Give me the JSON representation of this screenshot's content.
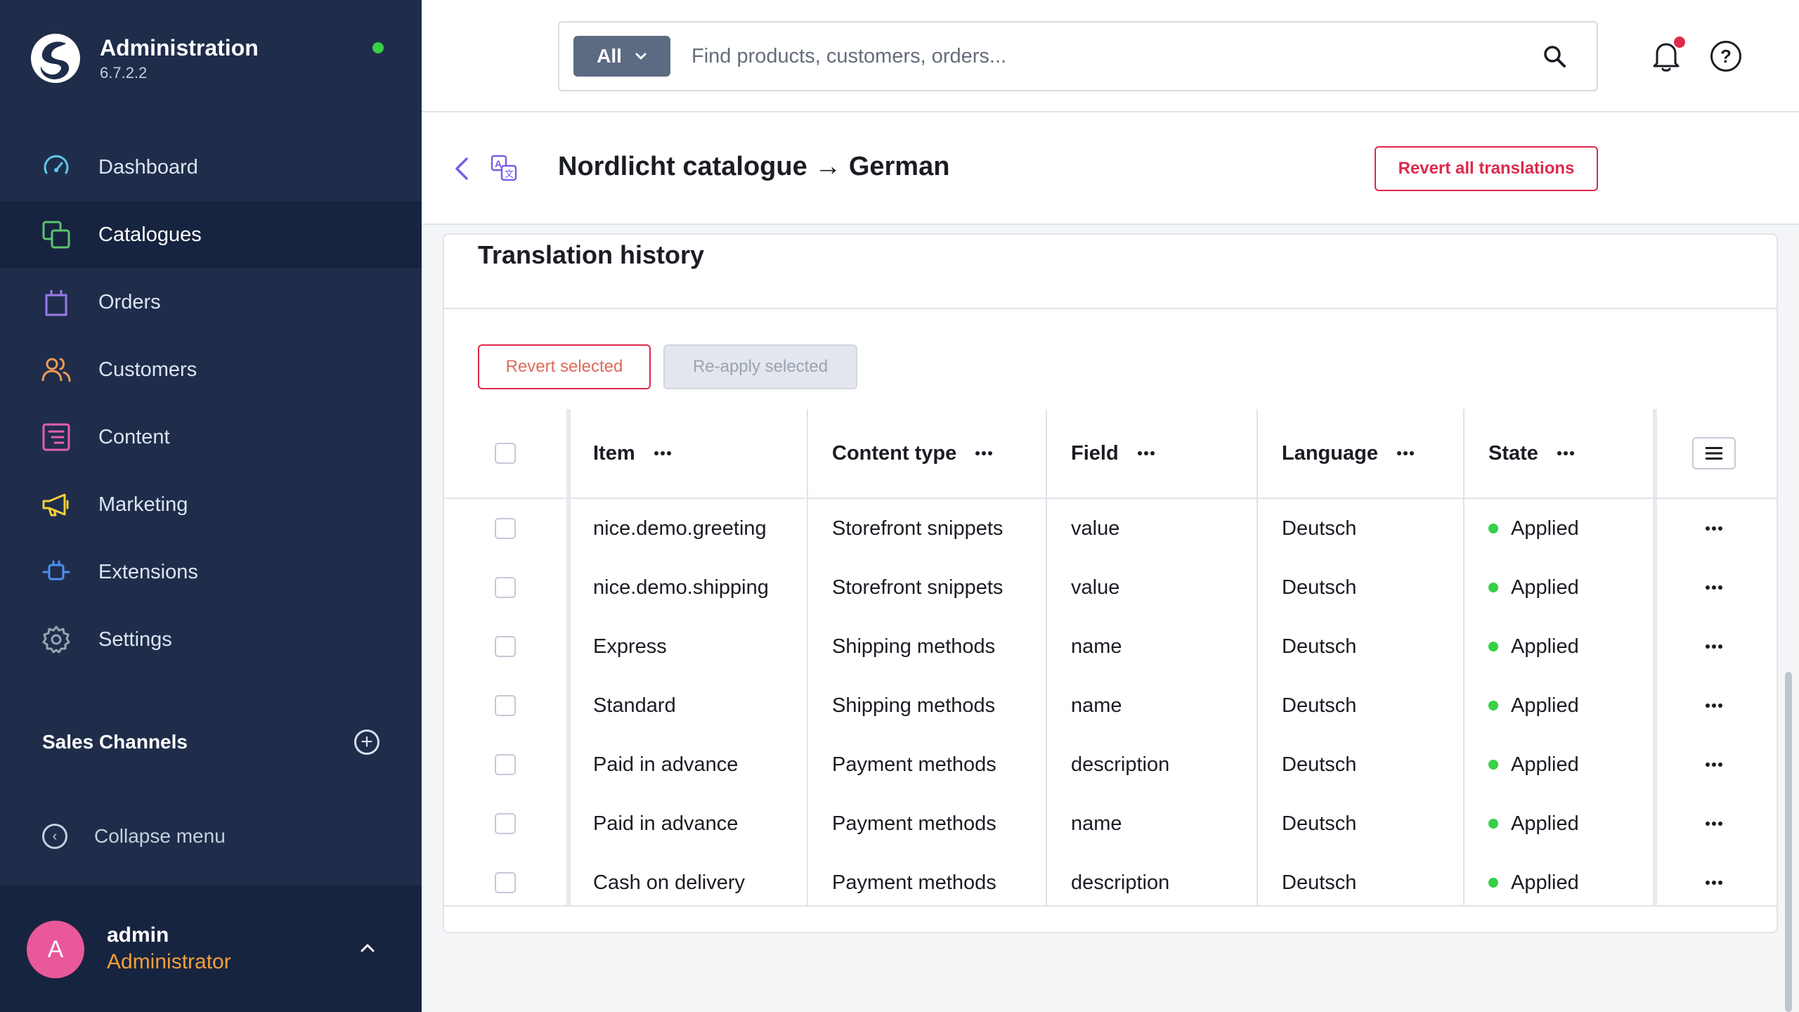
{
  "sidebar": {
    "brand": {
      "title": "Administration",
      "version": "6.7.2.2"
    },
    "nav": [
      {
        "label": "Dashboard",
        "icon": "dashboard-icon",
        "color": "#5ec8e8"
      },
      {
        "label": "Catalogues",
        "icon": "catalogues-icon",
        "color": "#5ec46b"
      },
      {
        "label": "Orders",
        "icon": "orders-icon",
        "color": "#9b7be8"
      },
      {
        "label": "Customers",
        "icon": "customers-icon",
        "color": "#f09a56"
      },
      {
        "label": "Content",
        "icon": "content-icon",
        "color": "#e35fae"
      },
      {
        "label": "Marketing",
        "icon": "marketing-icon",
        "color": "#f5cf3a"
      },
      {
        "label": "Extensions",
        "icon": "extensions-icon",
        "color": "#4f8ff0"
      },
      {
        "label": "Settings",
        "icon": "settings-icon",
        "color": "#9aa3b2"
      }
    ],
    "active": "Catalogues",
    "sales_channels": "Sales Channels",
    "collapse_label": "Collapse menu",
    "user": {
      "initial": "A",
      "name": "admin",
      "role": "Administrator"
    }
  },
  "topbar": {
    "search_type": "All",
    "search_placeholder": "Find products, customers, orders..."
  },
  "pagehead": {
    "title": "Nordlicht catalogue → German",
    "revert_all_label": "Revert all translations"
  },
  "card": {
    "title": "Translation history",
    "revert_selected_label": "Revert selected",
    "reapply_selected_label": "Re-apply selected"
  },
  "table": {
    "columns": [
      "Item",
      "Content type",
      "Field",
      "Language",
      "State"
    ],
    "rows": [
      {
        "item": "nice.demo.greeting",
        "content_type": "Storefront snippets",
        "field": "value",
        "language": "Deutsch",
        "state": "Applied"
      },
      {
        "item": "nice.demo.shipping",
        "content_type": "Storefront snippets",
        "field": "value",
        "language": "Deutsch",
        "state": "Applied"
      },
      {
        "item": "Express",
        "content_type": "Shipping methods",
        "field": "name",
        "language": "Deutsch",
        "state": "Applied"
      },
      {
        "item": "Standard",
        "content_type": "Shipping methods",
        "field": "name",
        "language": "Deutsch",
        "state": "Applied"
      },
      {
        "item": "Paid in advance",
        "content_type": "Payment methods",
        "field": "description",
        "language": "Deutsch",
        "state": "Applied"
      },
      {
        "item": "Paid in advance",
        "content_type": "Payment methods",
        "field": "name",
        "language": "Deutsch",
        "state": "Applied"
      },
      {
        "item": "Cash on delivery",
        "content_type": "Payment methods",
        "field": "description",
        "language": "Deutsch",
        "state": "Applied"
      }
    ]
  },
  "colors": {
    "sidebar_bg": "#1f2d4b",
    "active_nav_bg": "#172440",
    "danger": "#de294c",
    "status_online": "#37d046",
    "role_accent": "#f59f3a",
    "avatar_bg": "#e8589a"
  }
}
